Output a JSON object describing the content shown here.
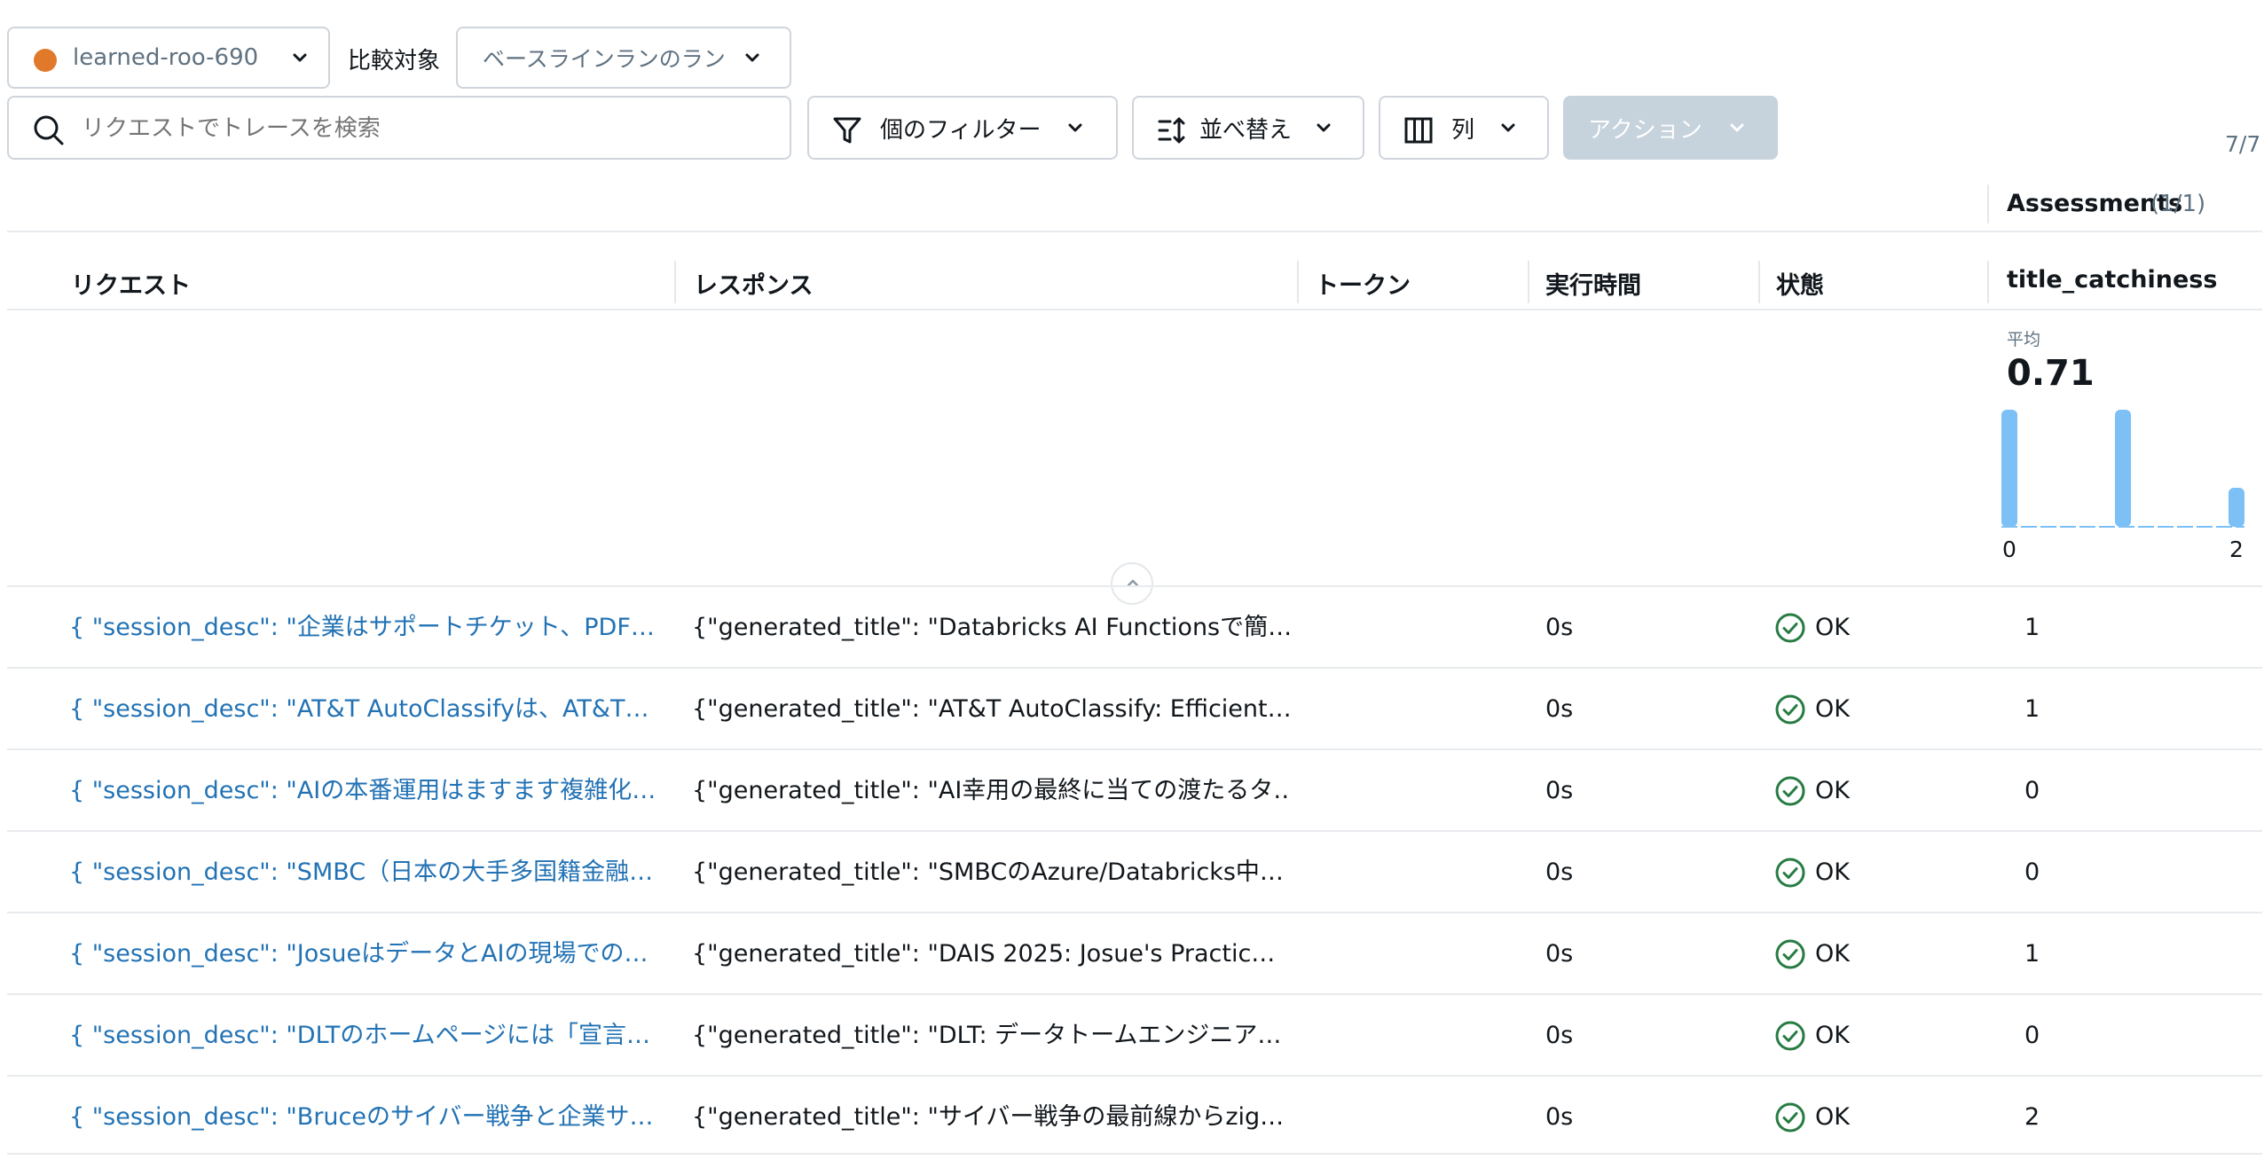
{
  "run_selector": {
    "value": "learned-roo-690",
    "dot_color": "#e07a2a"
  },
  "compare_label": "比較対象",
  "baseline_selector": {
    "value": "ベースラインランのラン"
  },
  "search": {
    "placeholder": "リクエストでトレースを検索"
  },
  "toolbar": {
    "filter_label": "個のフィルター",
    "sort_label": "並べ替え",
    "columns_label": "列",
    "actions_label": "アクション"
  },
  "count": "7/7",
  "assessments": {
    "label": "Assessments",
    "count": "(1/1)"
  },
  "columns": {
    "request": "リクエスト",
    "response": "レスポンス",
    "tokens": "トークン",
    "exec_time": "実行時間",
    "status": "状態",
    "title_catchiness": "title_catchiness"
  },
  "summary": {
    "avg_label": "平均",
    "avg_value": "0.71"
  },
  "chart_data": {
    "type": "bar",
    "categories": [
      "0",
      "1",
      "2"
    ],
    "values": [
      3,
      3,
      1
    ],
    "xlim": [
      0,
      2
    ],
    "tick_labels": [
      "0",
      "2"
    ],
    "color": "#7cc0f5"
  },
  "rows": [
    {
      "request": "{ \"session_desc\": \"企業はサポートチケット、PDF…",
      "response": "{\"generated_title\": \"Databricks AI Functionsで簡…",
      "tokens": "",
      "exec_time": "0s",
      "status": "OK",
      "score": "1"
    },
    {
      "request": "{ \"session_desc\": \"AT&T AutoClassifyは、AT&T…",
      "response": "{\"generated_title\": \"AT&T AutoClassify: Efficient…",
      "tokens": "",
      "exec_time": "0s",
      "status": "OK",
      "score": "1"
    },
    {
      "request": "{ \"session_desc\": \"AIの本番運用はますます複雑化…",
      "response": "{\"generated_title\": \"AI幸用の最終に当ての渡たるタ…",
      "tokens": "",
      "exec_time": "0s",
      "status": "OK",
      "score": "0"
    },
    {
      "request": "{ \"session_desc\": \"SMBC（日本の大手多国籍金融…",
      "response": "{\"generated_title\": \"SMBCのAzure/Databricks中…",
      "tokens": "",
      "exec_time": "0s",
      "status": "OK",
      "score": "0"
    },
    {
      "request": "{ \"session_desc\": \"JosueはデータとAIの現場での…",
      "response": "{\"generated_title\": \"DAIS 2025: Josue's Practic…",
      "tokens": "",
      "exec_time": "0s",
      "status": "OK",
      "score": "1"
    },
    {
      "request": "{ \"session_desc\": \"DLTのホームページには「宣言…",
      "response": "{\"generated_title\": \"DLT: データトームエンジニア…",
      "tokens": "",
      "exec_time": "0s",
      "status": "OK",
      "score": "0"
    },
    {
      "request": "{ \"session_desc\": \"Bruceのサイバー戦争と企業サ…",
      "response": "{\"generated_title\": \"サイバー戦争の最前線からzig…",
      "tokens": "",
      "exec_time": "0s",
      "status": "OK",
      "score": "2"
    }
  ]
}
